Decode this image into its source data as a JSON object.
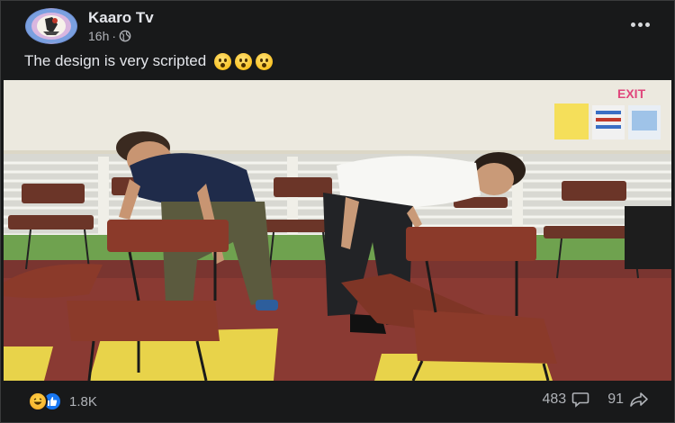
{
  "post": {
    "page_name": "Kaaro Tv",
    "time": "16h",
    "separator": "·",
    "caption": "The design is very scripted",
    "caption_emojis": [
      "hushed-face-emoji",
      "hushed-face-emoji",
      "hushed-face-emoji"
    ],
    "photo": {
      "sign_exit": "EXIT"
    }
  },
  "footer": {
    "reaction_icons": [
      "haha-icon",
      "like-icon"
    ],
    "reaction_count": "1.8K",
    "comment_count": "483",
    "share_count": "91"
  },
  "colors": {
    "background": "#18191a",
    "text_primary": "#e4e6eb",
    "text_secondary": "#b0b3b8",
    "like_blue": "#1877f2",
    "exit_sign": "#e0467c"
  }
}
